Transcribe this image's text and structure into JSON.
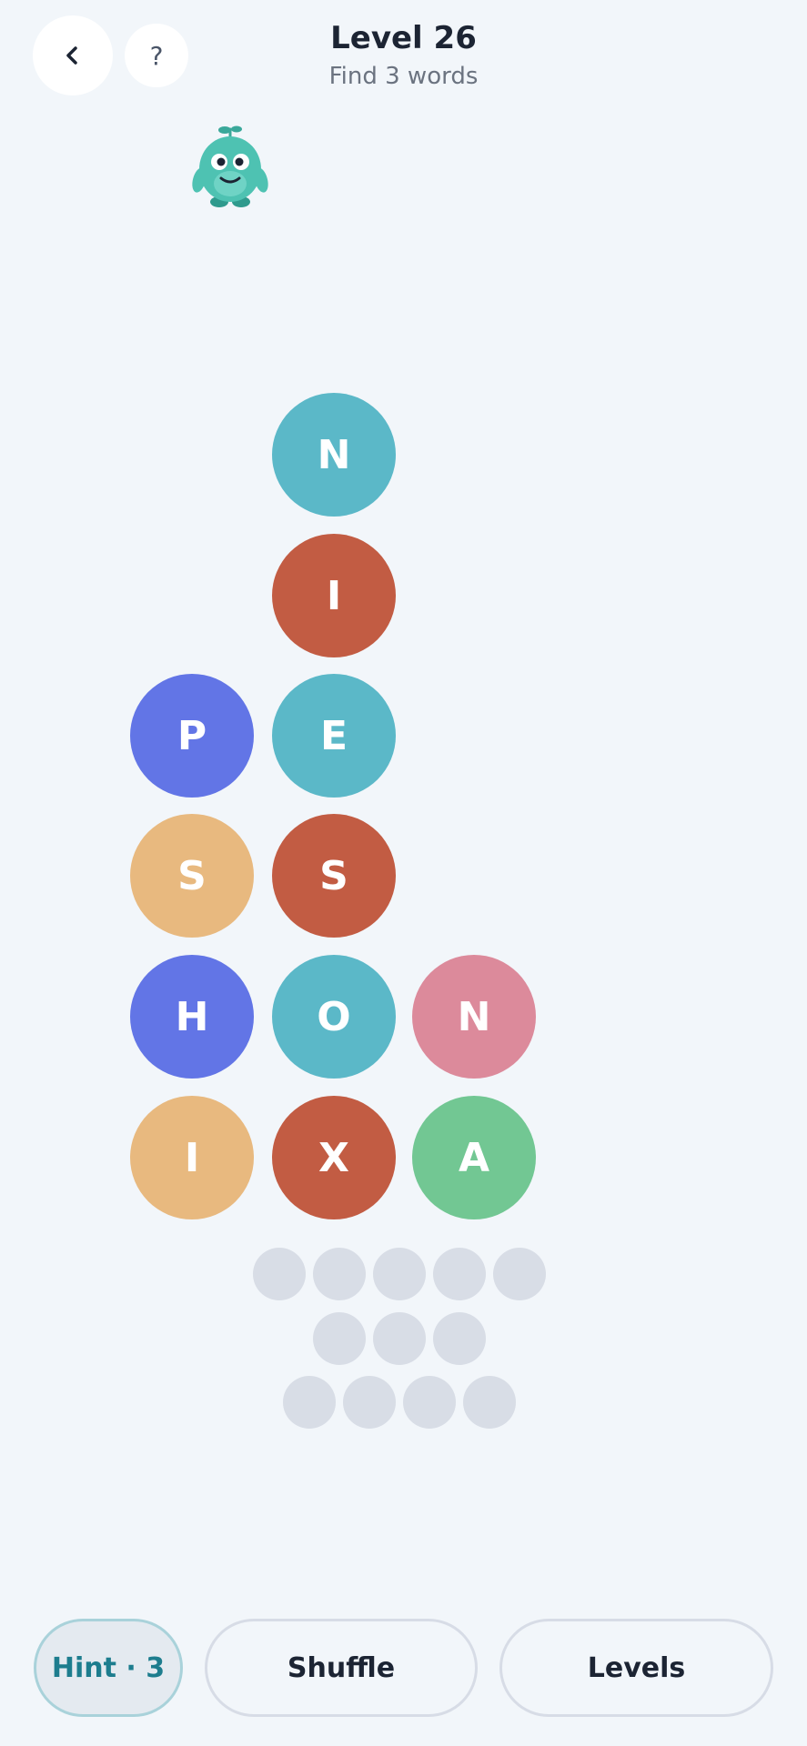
{
  "header": {
    "back_icon": "chevron-left-icon",
    "help_label": "?",
    "title": "Level 26",
    "subtitle": "Find 3 words"
  },
  "mascot": {
    "icon": "mascot-icon"
  },
  "colors": {
    "teal": "#5bb8c8",
    "red": "#c25c43",
    "blue": "#6275e6",
    "orange": "#e8b97f",
    "pink": "#dc8a9b",
    "green": "#72c793",
    "slot": "#d8dde6"
  },
  "board": {
    "tiles": [
      {
        "letter": "N",
        "color": "#5bb8c8"
      },
      {
        "letter": "I",
        "color": "#c25c43"
      },
      {
        "letter": "P",
        "color": "#6275e6"
      },
      {
        "letter": "E",
        "color": "#5bb8c8"
      },
      {
        "letter": "S",
        "color": "#e8b97f"
      },
      {
        "letter": "S",
        "color": "#c25c43"
      },
      {
        "letter": "H",
        "color": "#6275e6"
      },
      {
        "letter": "O",
        "color": "#5bb8c8"
      },
      {
        "letter": "N",
        "color": "#dc8a9b"
      },
      {
        "letter": "I",
        "color": "#e8b97f"
      },
      {
        "letter": "X",
        "color": "#c25c43"
      },
      {
        "letter": "A",
        "color": "#72c793"
      }
    ]
  },
  "word_slots": [
    5,
    3,
    4
  ],
  "footer": {
    "hint_label": "Hint · 3",
    "shuffle_label": "Shuffle",
    "levels_label": "Levels"
  }
}
